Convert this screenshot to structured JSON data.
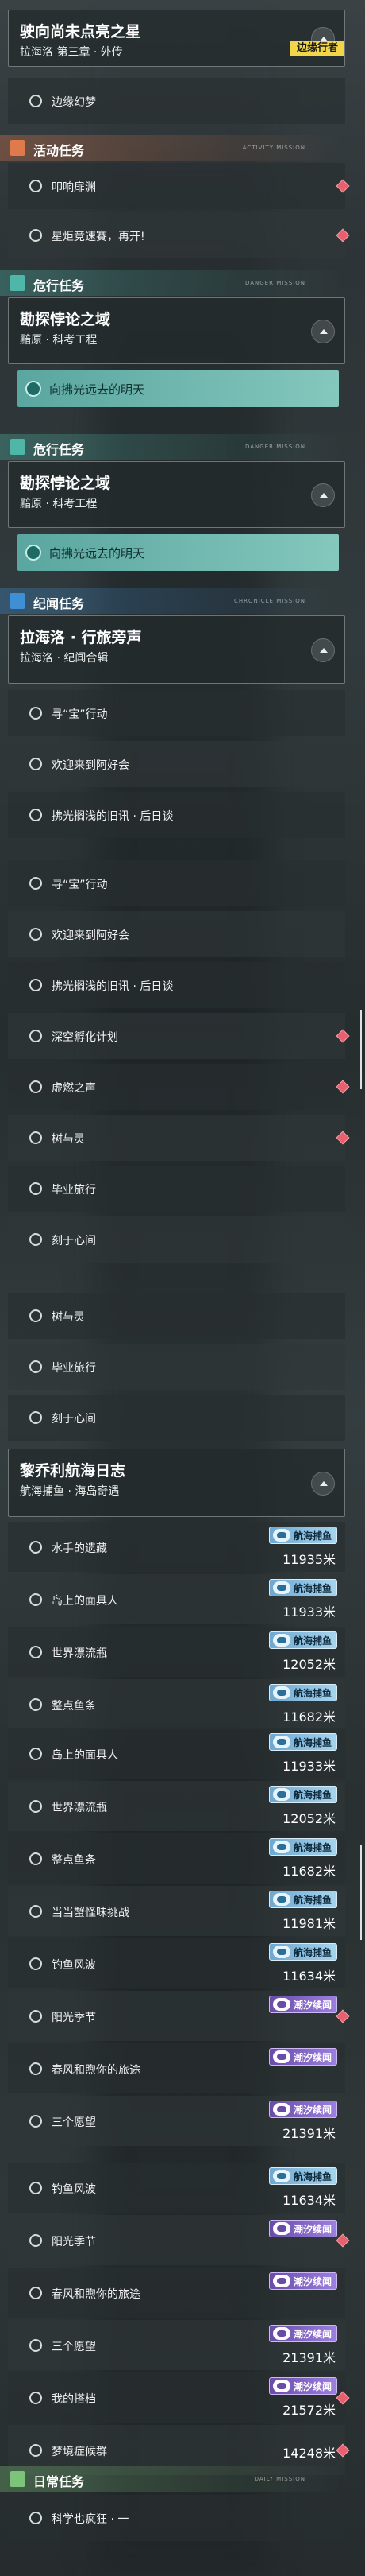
{
  "q1": {
    "title": "驶向尚未点亮之星",
    "sub": "拉海洛 第三章 · 外传",
    "badge": "边缘行者",
    "items": [
      "边缘幻梦"
    ]
  },
  "sec_activity": {
    "label": "活动任务",
    "tag": "ACTIVITY MISSION"
  },
  "activity_items": [
    "叩响扉渊",
    "星炬竞速賽，再开!"
  ],
  "sec_danger1": {
    "label": "危行任务",
    "tag": "DANGER MISSION"
  },
  "danger1": {
    "title": "勘探悖论之域",
    "sub": "黯原 · 科考工程",
    "pill": "向拂光远去的明天"
  },
  "sec_danger2": {
    "label": "危行任务",
    "tag": "DANGER MISSION"
  },
  "danger2": {
    "title": "勘探悖论之域",
    "sub": "黯原 · 科考工程",
    "pill": "向拂光远去的明天"
  },
  "sec_chronicle": {
    "label": "纪闻任务",
    "tag": "CHRONICLE MISSION"
  },
  "chron": {
    "title": "拉海洛 · 行旅旁声",
    "sub": "拉海洛 · 纪闻合辑"
  },
  "chron_items_a": [
    "寻“宝”行动",
    "欢迎来到阿好会",
    "拂光搁浅的旧讯 · 后日谈"
  ],
  "chron_items_b": [
    "寻“宝”行动",
    "欢迎来到阿好会",
    "拂光搁浅的旧讯 · 后日谈",
    "深空孵化计划",
    "虚燃之声",
    "树与灵",
    "毕业旅行",
    "刻于心间"
  ],
  "chron_items_c": [
    "树与灵",
    "毕业旅行",
    "刻于心间"
  ],
  "voyage": {
    "title": "黎乔利航海日志",
    "sub": "航海捕鱼 · 海岛奇遇"
  },
  "badge_sea": "航海捕鱼",
  "badge_tide": "潮汐续闻",
  "voyage_a": [
    {
      "l": "水手的遗藏",
      "m": "11935米"
    },
    {
      "l": "岛上的面具人",
      "m": "11933米"
    },
    {
      "l": "世界漂流瓶",
      "m": "12052米"
    },
    {
      "l": "整点鱼条",
      "m": "11682米"
    }
  ],
  "voyage_b": [
    {
      "l": "岛上的面具人",
      "m": "11933米"
    },
    {
      "l": "世界漂流瓶",
      "m": "12052米"
    },
    {
      "l": "整点鱼条",
      "m": "11682米"
    },
    {
      "l": "当当蟹怪味挑战",
      "m": "11981米"
    },
    {
      "l": "钓鱼风波",
      "m": "11634米"
    }
  ],
  "tide_a": [
    {
      "l": "阳光季节",
      "m": ""
    },
    {
      "l": "春风和煦你的旅途",
      "m": ""
    },
    {
      "l": "三个愿望",
      "m": "21391米"
    }
  ],
  "voyage_c": [
    {
      "l": "钓鱼风波",
      "m": "11634米"
    }
  ],
  "tide_b": [
    {
      "l": "阳光季节",
      "m": ""
    },
    {
      "l": "春风和煦你的旅途",
      "m": ""
    },
    {
      "l": "三个愿望",
      "m": "21391米"
    },
    {
      "l": "我的搭档",
      "m": "21572米"
    }
  ],
  "plain_c": [
    {
      "l": "梦境症候群",
      "m": "14248米"
    }
  ],
  "sec_daily": {
    "label": "日常任务",
    "tag": "DAILY MISSION"
  },
  "daily_items": [
    "科学也疯狂 · 一"
  ],
  "colors": {
    "activity": "#e07a4a",
    "danger": "#4fb7a8",
    "chronicle": "#3e8fd4",
    "daily": "#7cc47a",
    "alert": "#e86070"
  }
}
